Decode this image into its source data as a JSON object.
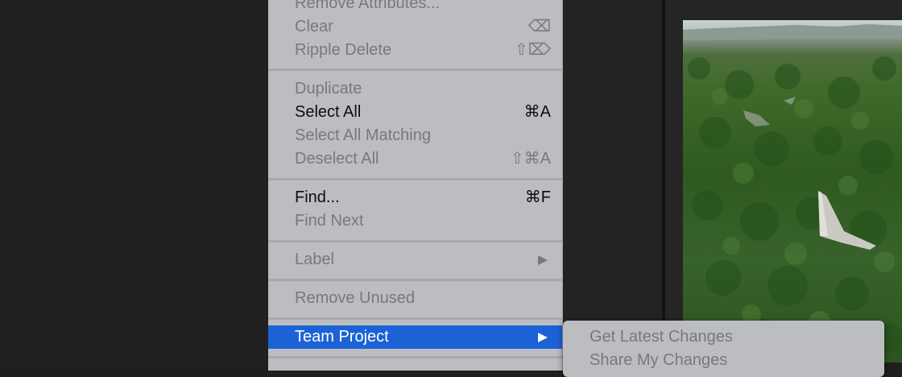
{
  "menu": {
    "items": [
      {
        "label": "Remove Attributes...",
        "shortcut": "",
        "enabled": false
      },
      {
        "label": "Clear",
        "shortcut": "⌫",
        "enabled": false
      },
      {
        "label": "Ripple Delete",
        "shortcut": "⇧⌦",
        "enabled": false
      },
      {
        "label": "Duplicate",
        "shortcut": "",
        "enabled": false
      },
      {
        "label": "Select All",
        "shortcut": "⌘A",
        "enabled": true
      },
      {
        "label": "Select All Matching",
        "shortcut": "",
        "enabled": false
      },
      {
        "label": "Deselect All",
        "shortcut": "⇧⌘A",
        "enabled": false
      },
      {
        "label": "Find...",
        "shortcut": "⌘F",
        "enabled": true
      },
      {
        "label": "Find Next",
        "shortcut": "",
        "enabled": false
      },
      {
        "label": "Label",
        "shortcut": "",
        "enabled": false,
        "submenu_icon": "submenu-arrow-icon"
      },
      {
        "label": "Remove Unused",
        "shortcut": "",
        "enabled": false
      },
      {
        "label": "Team Project",
        "shortcut": "",
        "enabled": true,
        "highlighted": true,
        "submenu_icon": "submenu-arrow-icon"
      }
    ]
  },
  "submenu": {
    "items": [
      {
        "label": "Get Latest Changes",
        "enabled": false
      },
      {
        "label": "Share My Changes",
        "enabled": false
      }
    ]
  },
  "colors": {
    "highlight": "#1b62d6",
    "menu_background": "#bcbdc1",
    "disabled_text": "#78797d"
  }
}
